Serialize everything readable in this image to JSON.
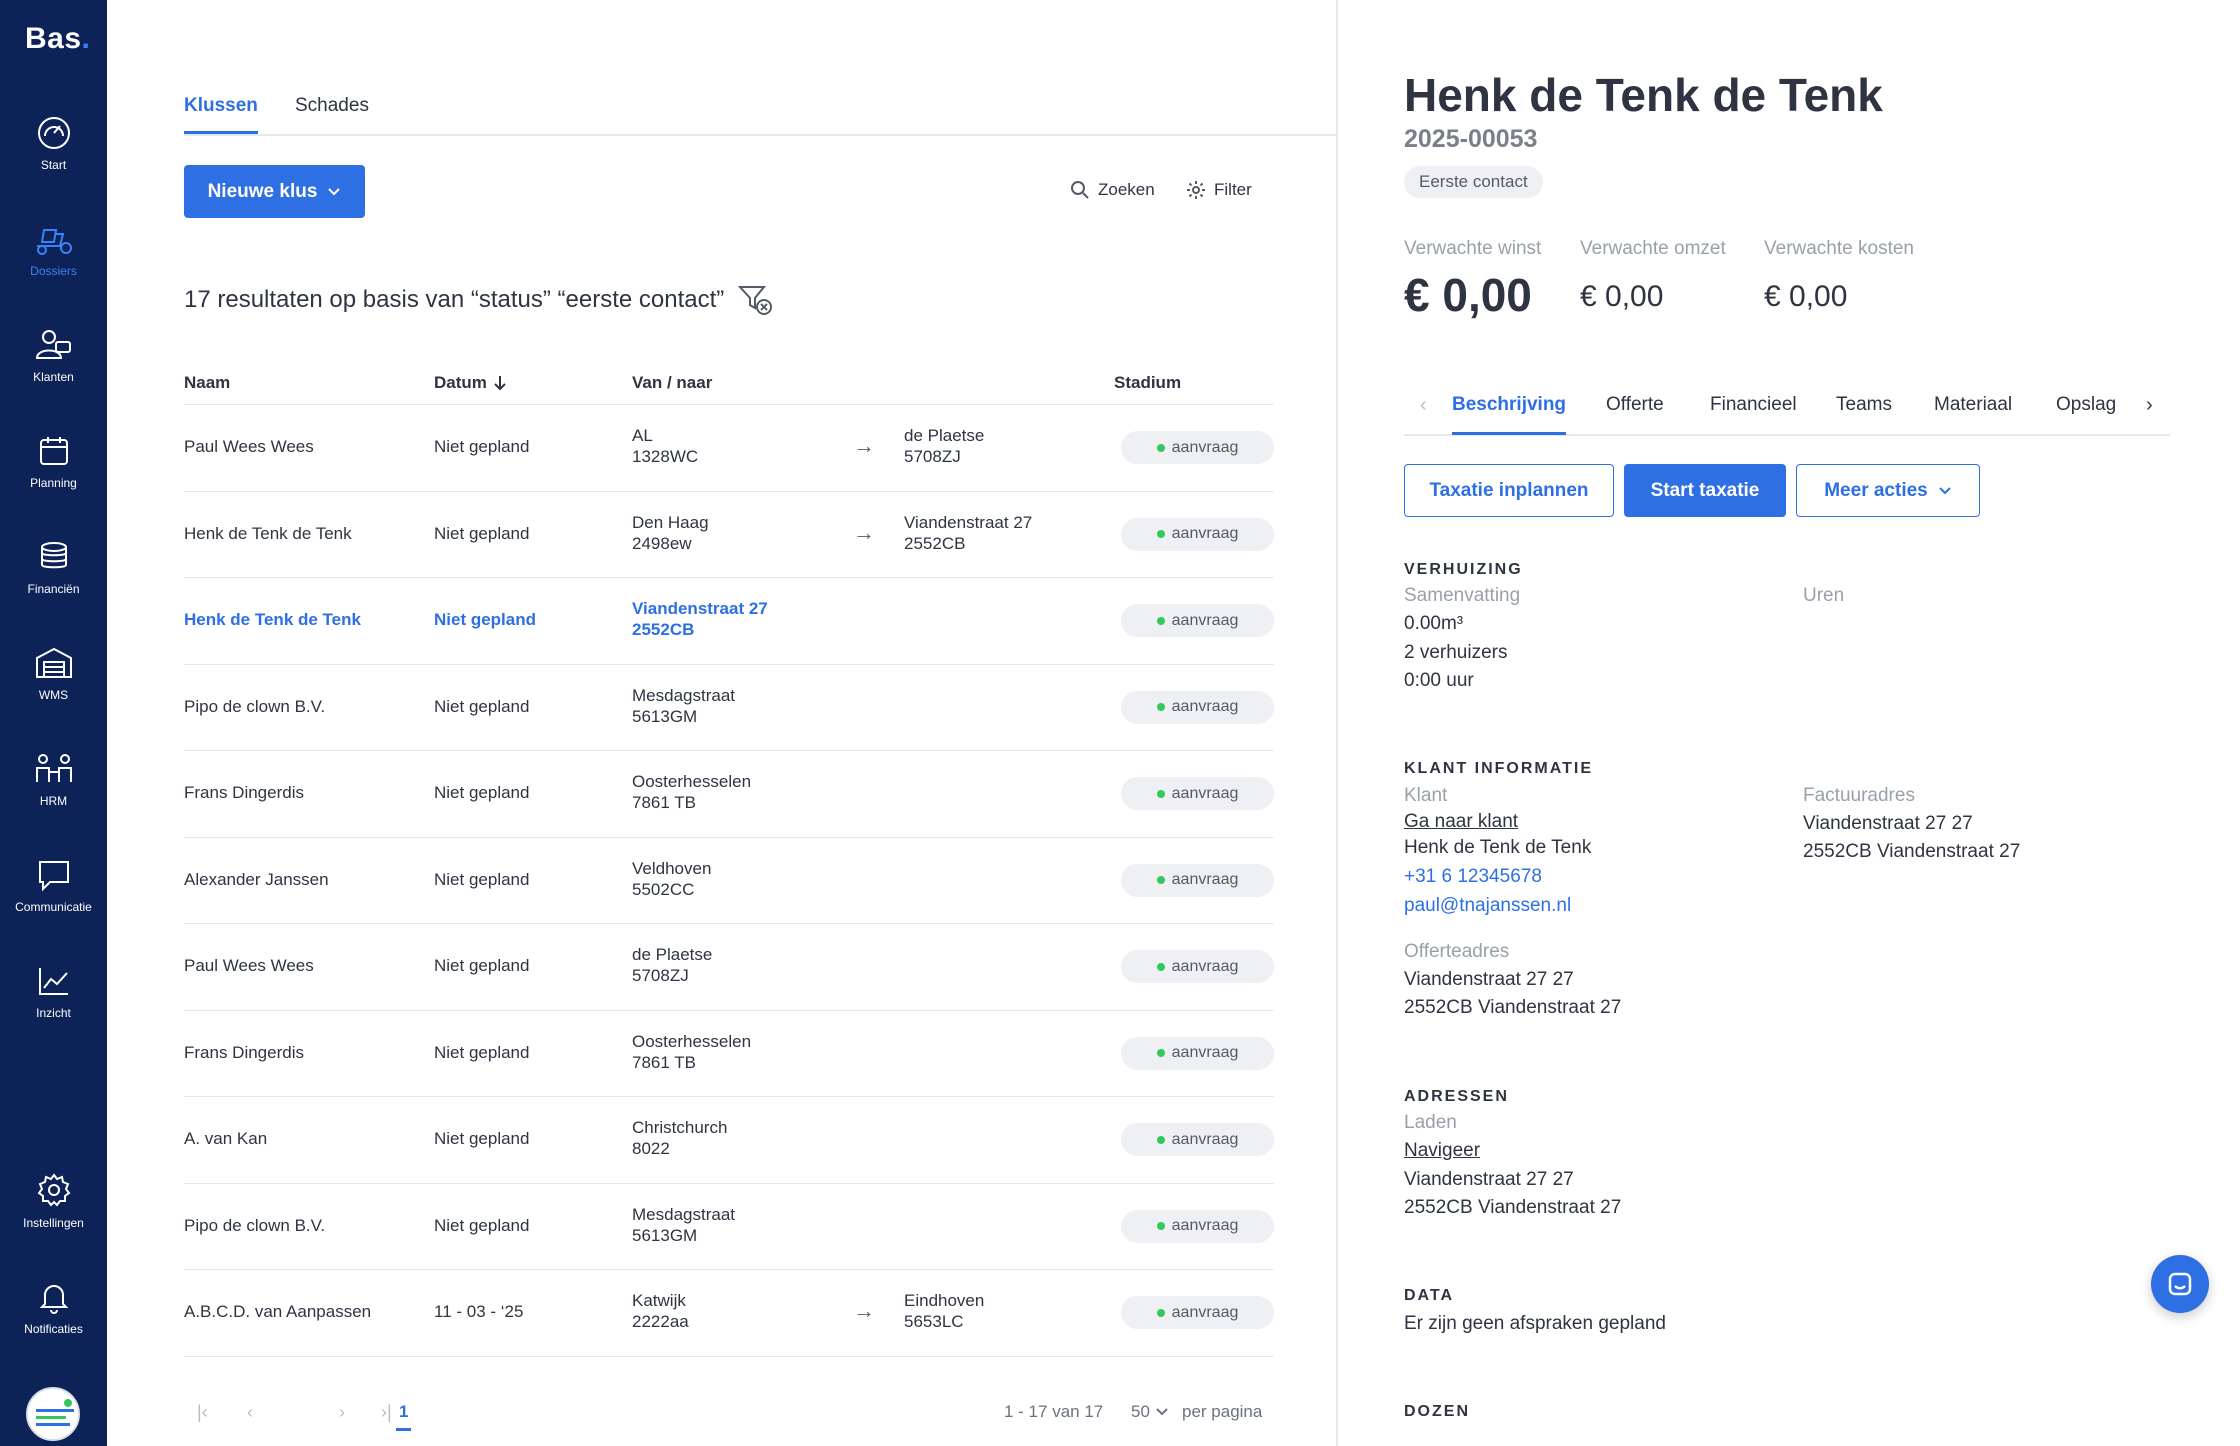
{
  "sidebar": {
    "logo": "Bas",
    "logo_dot": ".",
    "items": [
      {
        "label": "Start",
        "icon": "dashboard-gauge-icon"
      },
      {
        "label": "Dossiers",
        "icon": "dossiers-scooter-icon",
        "active": true
      },
      {
        "label": "Klanten",
        "icon": "customers-icon"
      },
      {
        "label": "Planning",
        "icon": "calendar-icon"
      },
      {
        "label": "Financiën",
        "icon": "coins-icon"
      },
      {
        "label": "WMS",
        "icon": "warehouse-icon"
      },
      {
        "label": "HRM",
        "icon": "people-icon"
      },
      {
        "label": "Communicatie",
        "icon": "chat-icon"
      },
      {
        "label": "Inzicht",
        "icon": "chart-line-icon"
      },
      {
        "label": "Instellingen",
        "icon": "gear-icon"
      },
      {
        "label": "Notificaties",
        "icon": "bell-icon"
      }
    ]
  },
  "main": {
    "tabs": [
      {
        "label": "Klussen",
        "active": true
      },
      {
        "label": "Schades",
        "active": false
      }
    ],
    "new_button": "Nieuwe klus",
    "search_label": "Zoeken",
    "filter_label": "Filter",
    "results_text": "17 resultaten op basis van “status” “eerste contact”",
    "columns": {
      "naam": "Naam",
      "datum": "Datum",
      "van_naar": "Van / naar",
      "stadium": "Stadium"
    },
    "rows": [
      {
        "naam": "Paul Wees Wees",
        "datum": "Niet gepland",
        "van1": "AL",
        "van2": "1328WC",
        "arrow": "→",
        "naar1": "de Plaetse",
        "naar2": "5708ZJ",
        "stadium": "aanvraag"
      },
      {
        "naam": "Henk de Tenk de Tenk",
        "datum": "Niet gepland",
        "van1": "Den Haag",
        "van2": "2498ew",
        "arrow": "→",
        "naar1": "Viandenstraat 27",
        "naar2": "2552CB",
        "stadium": "aanvraag"
      },
      {
        "naam": "Henk de Tenk de Tenk",
        "datum": "Niet gepland",
        "van1": "Viandenstraat 27",
        "van2": "2552CB",
        "arrow": "",
        "naar1": "",
        "naar2": "",
        "stadium": "aanvraag",
        "highlight": true
      },
      {
        "naam": "Pipo de clown B.V.",
        "datum": "Niet gepland",
        "van1": "Mesdagstraat",
        "van2": "5613GM",
        "arrow": "",
        "naar1": "",
        "naar2": "",
        "stadium": "aanvraag"
      },
      {
        "naam": "Frans Dingerdis",
        "datum": "Niet gepland",
        "van1": "Oosterhesselen",
        "van2": "7861 TB",
        "arrow": "",
        "naar1": "",
        "naar2": "",
        "stadium": "aanvraag"
      },
      {
        "naam": "Alexander Janssen",
        "datum": "Niet gepland",
        "van1": "Veldhoven",
        "van2": "5502CC",
        "arrow": "",
        "naar1": "",
        "naar2": "",
        "stadium": "aanvraag"
      },
      {
        "naam": "Paul Wees Wees",
        "datum": "Niet gepland",
        "van1": "de Plaetse",
        "van2": "5708ZJ",
        "arrow": "",
        "naar1": "",
        "naar2": "",
        "stadium": "aanvraag"
      },
      {
        "naam": "Frans Dingerdis",
        "datum": "Niet gepland",
        "van1": "Oosterhesselen",
        "van2": "7861 TB",
        "arrow": "",
        "naar1": "",
        "naar2": "",
        "stadium": "aanvraag"
      },
      {
        "naam": "A. van Kan",
        "datum": "Niet gepland",
        "van1": "Christchurch",
        "van2": "8022",
        "arrow": "",
        "naar1": "",
        "naar2": "",
        "stadium": "aanvraag"
      },
      {
        "naam": "Pipo de clown B.V.",
        "datum": "Niet gepland",
        "van1": "Mesdagstraat",
        "van2": "5613GM",
        "arrow": "",
        "naar1": "",
        "naar2": "",
        "stadium": "aanvraag"
      },
      {
        "naam": "A.B.C.D. van Aanpassen",
        "datum": "11 - 03 - ‘25",
        "van1": "Katwijk",
        "van2": "2222aa",
        "arrow": "→",
        "naar1": "Eindhoven",
        "naar2": "5653LC",
        "stadium": "aanvraag"
      }
    ],
    "pagination": {
      "current_page": "1",
      "range_text": "1 - 17 van 17",
      "per_page_value": "50",
      "per_page_label": "per pagina"
    }
  },
  "detail": {
    "title": "Henk de Tenk de Tenk",
    "number": "2025-00053",
    "status": "Eerste contact",
    "metrics": [
      {
        "label": "Verwachte winst",
        "value": "€ 0,00"
      },
      {
        "label": "Verwachte omzet",
        "value": "€ 0,00"
      },
      {
        "label": "Verwachte kosten",
        "value": "€ 0,00"
      }
    ],
    "tabs": [
      "Beschrijving",
      "Offerte",
      "Financieel",
      "Teams",
      "Materiaal",
      "Opslag"
    ],
    "buttons": {
      "taxatie_inplannen": "Taxatie inplannen",
      "start_taxatie": "Start taxatie",
      "meer_acties": "Meer acties"
    },
    "verhuizing": {
      "title": "VERHUIZING",
      "samenvatting_label": "Samenvatting",
      "uren_label": "Uren",
      "volume": "0.00m³",
      "verhuizers": "2 verhuizers",
      "uren": "0:00 uur"
    },
    "klant": {
      "title": "KLANT INFORMATIE",
      "klant_label": "Klant",
      "ga_naar_klant": "Ga naar klant",
      "naam": "Henk de Tenk de Tenk",
      "telefoon": "+31 6 12345678",
      "email": "paul@tnajanssen.nl",
      "factuuradres_label": "Factuuradres",
      "factuur_line1": "Viandenstraat 27 27",
      "factuur_line2": "2552CB Viandenstraat 27",
      "offerteadres_label": "Offerteadres",
      "offerte_line1": "Viandenstraat 27 27",
      "offerte_line2": "2552CB Viandenstraat 27"
    },
    "adressen": {
      "title": "ADRESSEN",
      "laden_label": "Laden",
      "navigeer": "Navigeer",
      "line1": "Viandenstraat 27 27",
      "line2": "2552CB Viandenstraat 27"
    },
    "data_section": {
      "title": "DATA",
      "text": "Er zijn geen afspraken gepland"
    },
    "dozen_title": "DOZEN"
  }
}
